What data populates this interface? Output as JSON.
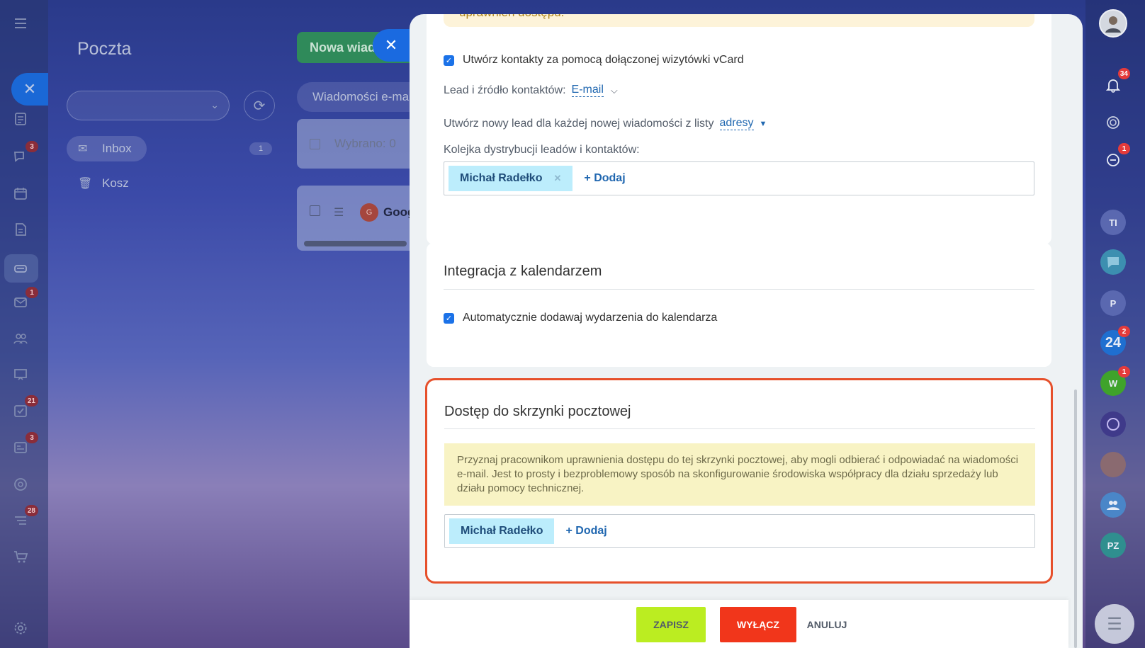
{
  "left_rail": {
    "badges": {
      "chat": "3",
      "mail": "1",
      "tasks": "21",
      "feed": "3",
      "automation": "28"
    }
  },
  "mail_app": {
    "title": "Poczta",
    "folders": [
      {
        "label": "Inbox",
        "count": "1"
      },
      {
        "label": "Kosz"
      }
    ],
    "new_message_label": "Nowa wiad",
    "search_placeholder": "Wiadomości e-ma",
    "selected_label": "Wybrano: 0",
    "mail_row": {
      "avatar": "G",
      "sender": "Goog"
    }
  },
  "right_rail": {
    "notifications_badge": "34",
    "chat_badge": "1",
    "avatars": [
      {
        "label": "TI",
        "color": "#5a68b0"
      },
      {
        "label": "P",
        "color": "#5a68b0"
      },
      {
        "label": "24",
        "color": "#1f6fd0",
        "badge": "2"
      },
      {
        "label": "W",
        "color": "#3fa32b",
        "badge": "1"
      },
      {
        "label": "PZ",
        "color": "#2f8f8f"
      }
    ]
  },
  "panel": {
    "warning_text": "uprawnień dostępu.",
    "vcard_label": "Utwórz kontakty za pomocą dołączonej wizytówki vCard",
    "source_label": "Lead i źródło kontaktów:",
    "source_value": "E-mail",
    "new_lead_label": "Utwórz nowy lead dla każdej nowej wiadomości z listy",
    "new_lead_value": "adresy",
    "queue_label": "Kolejka dystrybucji leadów i kontaktów:",
    "queue_user": "Michał Radełko",
    "add_label": "Dodaj",
    "calendar": {
      "title": "Integracja z kalendarzem",
      "auto_add_label": "Automatycznie dodawaj wydarzenia do kalendarza"
    },
    "access": {
      "title": "Dostęp do skrzynki pocztowej",
      "info": "Przyznaj pracownikom uprawnienia dostępu do tej skrzynki pocztowej, aby mogli odbierać i odpowiadać na wiadomości e-mail. Jest to prosty i bezproblemowy sposób na skonfigurowanie środowiska współpracy dla działu sprzedaży lub działu pomocy technicznej.",
      "user": "Michał Radełko",
      "add_label": "Dodaj"
    },
    "footer": {
      "save": "ZAPISZ",
      "disable": "WYŁĄCZ",
      "cancel": "ANULUJ"
    }
  },
  "colors": {
    "accent": "#1b72e8",
    "highlight_border": "#e6502b",
    "save": "#bbed21",
    "disable": "#f1361b"
  }
}
